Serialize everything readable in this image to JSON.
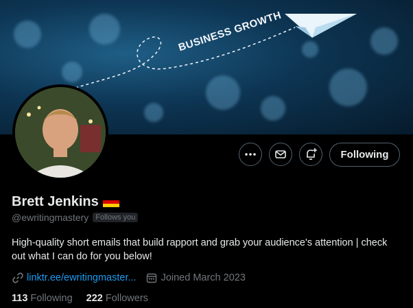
{
  "banner": {
    "text": "BUSINESS GROWTH"
  },
  "actions": {
    "more_icon": "more-horizontal-icon",
    "message_icon": "envelope-icon",
    "notify_icon": "bell-plus-icon",
    "following_label": "Following"
  },
  "profile": {
    "name": "Brett Jenkins",
    "flag": "germany-flag",
    "handle": "@ewritingmastery",
    "follows_you": "Follows you",
    "bio": "High-quality short emails that build rapport and grab your audience's attention | check out what I can do for you below!",
    "link": "linktr.ee/ewritingmaster...",
    "joined": "Joined March 2023",
    "following_count": "113",
    "following_label": "Following",
    "followers_count": "222",
    "followers_label": "Followers"
  },
  "colors": {
    "background": "#000000",
    "text_primary": "#e7e9ea",
    "text_secondary": "#71767b",
    "link": "#1d9bf0",
    "border": "#536471"
  }
}
